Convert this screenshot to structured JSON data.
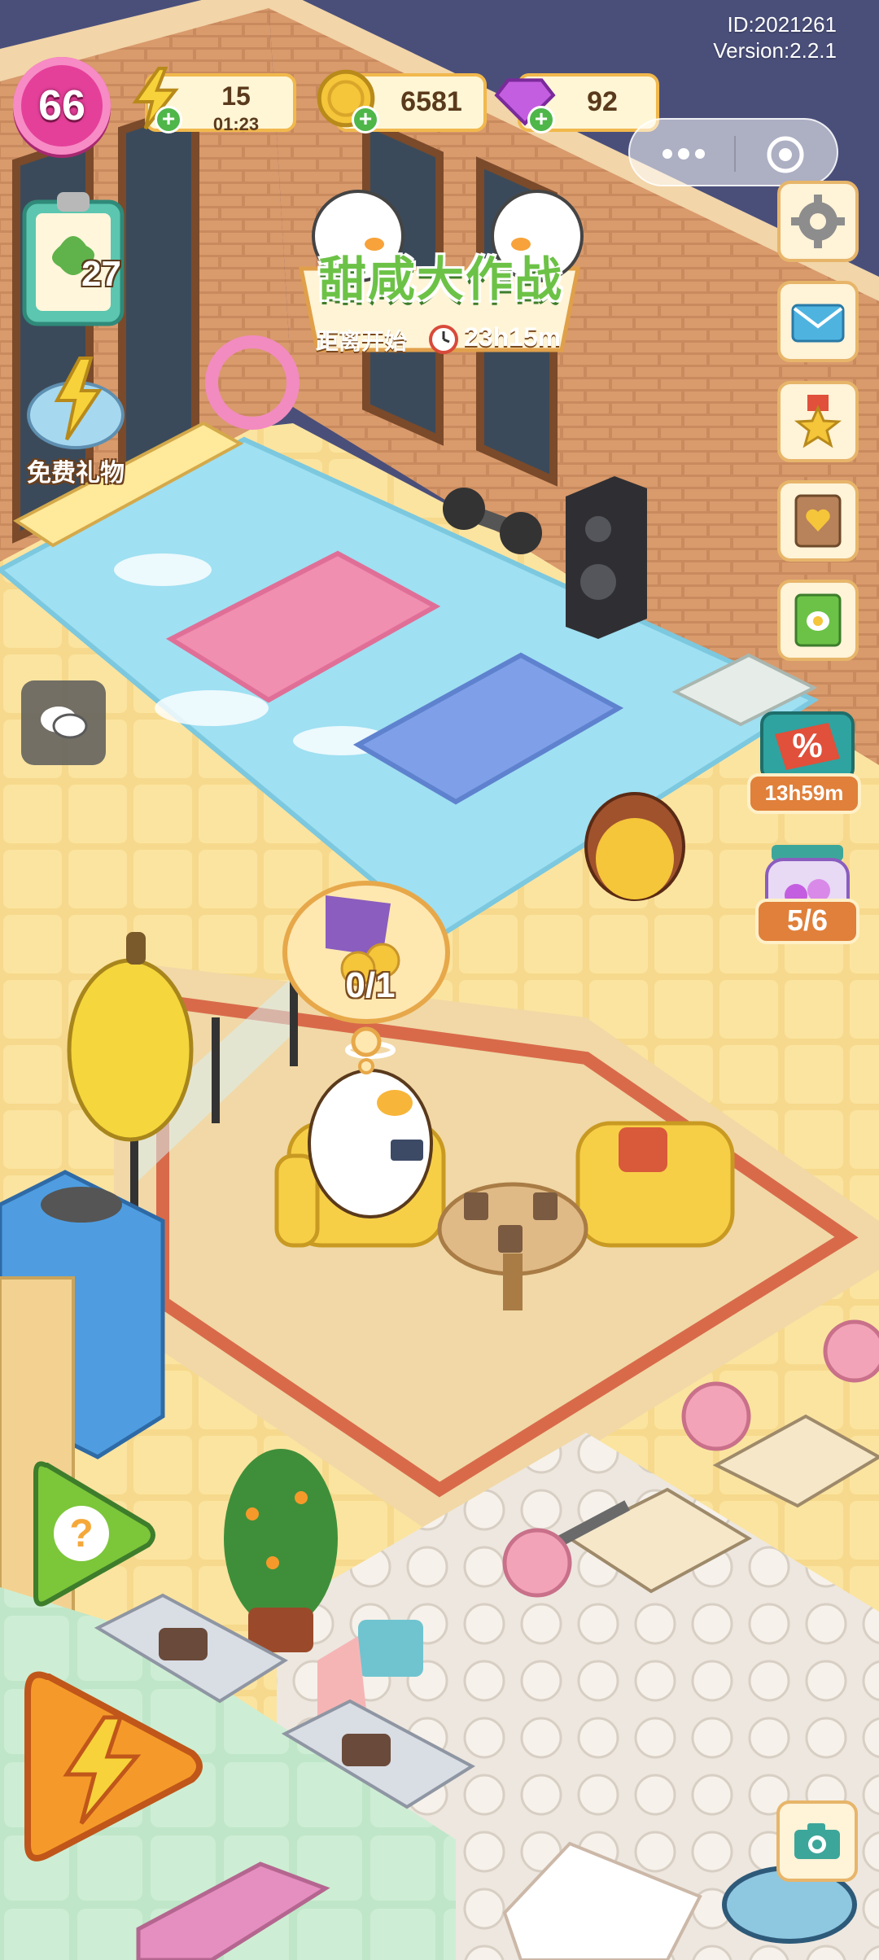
{
  "app": {
    "id_label": "ID:2021261",
    "version_label": "Version:2.2.1"
  },
  "hud": {
    "level": "66",
    "energy": {
      "value": "15",
      "timer": "01:23"
    },
    "coins": {
      "value": "6581"
    },
    "gems": {
      "value": "92"
    }
  },
  "quest": {
    "count": "27"
  },
  "free_gift": {
    "label": "免费礼物"
  },
  "event": {
    "title": "甜咸大作战",
    "countdown_label": "距离开始",
    "countdown": "23h15m"
  },
  "sale": {
    "timer": "13h59m",
    "icon": "percent-tag-icon"
  },
  "jar": {
    "progress": "5/6"
  },
  "thought_bubble": {
    "progress": "0/1"
  },
  "side_menu": [
    {
      "icon": "gear-icon"
    },
    {
      "icon": "mail-icon"
    },
    {
      "icon": "star-medal-icon"
    },
    {
      "icon": "heart-book-icon"
    },
    {
      "icon": "recipe-book-icon"
    }
  ],
  "colors": {
    "level_badge": "#e4409a",
    "wall_brick": "#c98a5e",
    "floor": "#f7dd8e",
    "mat_blue": "#9fe0f2",
    "accent_orange": "#e0803a",
    "accent_green": "#6cc246"
  }
}
